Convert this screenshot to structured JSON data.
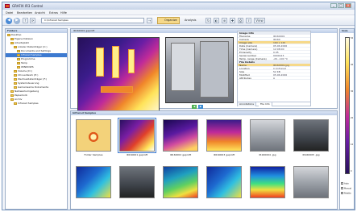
{
  "window": {
    "title": "GRAFIX IR3 Control",
    "minimize": "_",
    "maximize": "□",
    "close": "×"
  },
  "menu": {
    "items": [
      "Datei",
      "Bearbeiten",
      "Ansicht",
      "Extras",
      "Hilfe"
    ]
  },
  "toolbar": {
    "back": "◀",
    "forward": "▶",
    "address": "C:\\Infrared Samples",
    "organize_label": "Organize",
    "analysis_label": "Analysis",
    "view_label": "View"
  },
  "folders": {
    "header": "Folders",
    "items": [
      {
        "label": "Desktop",
        "indent": 0,
        "selected": false
      },
      {
        "label": "Eigene Dateien",
        "indent": 1,
        "selected": false
      },
      {
        "label": "Arbeitsplatz",
        "indent": 1,
        "selected": false
      },
      {
        "label": "Lokaler Datenträger (C:)",
        "indent": 2,
        "selected": false
      },
      {
        "label": "Documents and Settings",
        "indent": 3,
        "selected": false
      },
      {
        "label": "Infrared Samples",
        "indent": 3,
        "selected": true
      },
      {
        "label": "Programme",
        "indent": 3,
        "selected": false
      },
      {
        "label": "Temp",
        "indent": 3,
        "selected": false
      },
      {
        "label": "WINDOWS",
        "indent": 3,
        "selected": false
      },
      {
        "label": "Volume (D:)",
        "indent": 2,
        "selected": false
      },
      {
        "label": "CD-Laufwerk (E:)",
        "indent": 2,
        "selected": false
      },
      {
        "label": "Wechseldatenträger (F:)",
        "indent": 2,
        "selected": false
      },
      {
        "label": "Systemsteuerung",
        "indent": 2,
        "selected": false
      },
      {
        "label": "Gemeinsame Dokumente",
        "indent": 2,
        "selected": false
      },
      {
        "label": "Netzwerkumgebung",
        "indent": 1,
        "selected": false
      },
      {
        "label": "Papierkorb",
        "indent": 1,
        "selected": false
      },
      {
        "label": "Archiv",
        "indent": 1,
        "selected": false
      },
      {
        "label": "Infrared Samples",
        "indent": 2,
        "selected": false
      }
    ]
  },
  "preview": {
    "header": "IR160001 geprüft",
    "controls": [
      "◀",
      "▶"
    ]
  },
  "info": {
    "section1": "Image Info",
    "rows1": [
      {
        "key": "Filename",
        "value": "IR160001",
        "hl": false
      },
      {
        "key": "Camera",
        "value": "IR160",
        "hl": false
      },
      {
        "key": "Image size",
        "value": "160 x 120",
        "hl": true
      },
      {
        "key": "Date (Camera)",
        "value": "05.06.2006",
        "hl": false
      },
      {
        "key": "Time (Camera)",
        "value": "12:08:00",
        "hl": false
      },
      {
        "key": "Emissivity",
        "value": "0.95",
        "hl": false
      },
      {
        "key": "Serial number",
        "value": "0000123",
        "hl": false
      },
      {
        "key": "Temp. range (Camera)",
        "value": "-20...100 °C",
        "hl": false
      }
    ],
    "section2": "File Details",
    "rows2": [
      {
        "key": "Name",
        "value": "IR160001.jpg",
        "hl": true
      },
      {
        "key": "Location",
        "value": "C:\\Infrared",
        "hl": false
      },
      {
        "key": "Size",
        "value": "52 KB",
        "hl": false
      },
      {
        "key": "Modified",
        "value": "05.06.2006",
        "hl": false
      },
      {
        "key": "Attributes",
        "value": "A",
        "hl": false
      }
    ],
    "tabs": [
      "Annotations",
      "File Info"
    ]
  },
  "gallery": {
    "header": "Infrared Samples",
    "tiles": [
      {
        "label": "Folder Samples",
        "kind": "folder"
      },
      {
        "label": "IR160001 geprüft",
        "kind": "thermal-red"
      },
      {
        "label": "IR160002 geprüft",
        "kind": "thermal-purple"
      },
      {
        "label": "IR160003 geprüft",
        "kind": "thermal-orange"
      },
      {
        "label": "IR160004 .jpg",
        "kind": "photo"
      },
      {
        "label": "IR160005 .jpg",
        "kind": "photo-dark"
      },
      {
        "label": "IR160006 .jpg",
        "kind": "thermal-blue"
      },
      {
        "label": "IR160007 .jpg",
        "kind": "photo-dark"
      },
      {
        "label": "IR160008 .jpg",
        "kind": "thermal-green"
      },
      {
        "label": "IR160009 .jpg",
        "kind": "thermal-blue"
      },
      {
        "label": "IR160010 .jpg",
        "kind": "thermal-rainbow"
      },
      {
        "label": "IR160011 .jpg",
        "kind": "photo"
      }
    ]
  },
  "scale": {
    "header": "Scale",
    "ticks": [
      "50",
      "40",
      "30",
      "20",
      "10",
      "0"
    ],
    "options": [
      "Auto",
      "Manual",
      "Palette"
    ]
  },
  "colors": {
    "accent": "#3d7ad0",
    "highlight": "#f6d98a",
    "titlebar": "#c7d4e8"
  }
}
